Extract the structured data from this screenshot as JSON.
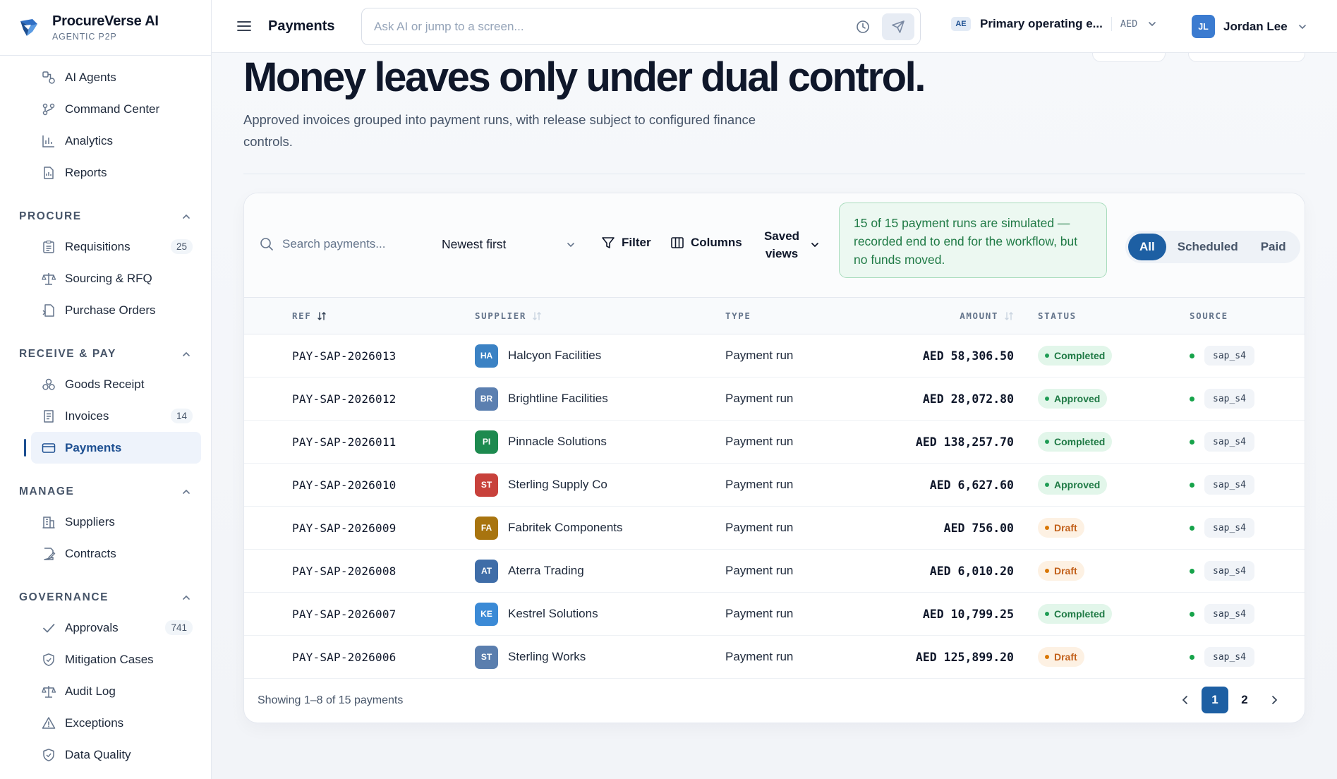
{
  "brand": {
    "name": "ProcureVerse AI",
    "subtitle": "AGENTIC P2P"
  },
  "sidebar": {
    "top_items": [
      {
        "label": "AI Agents",
        "icon": "agents-icon"
      },
      {
        "label": "Command Center",
        "icon": "command-icon"
      },
      {
        "label": "Analytics",
        "icon": "analytics-icon"
      },
      {
        "label": "Reports",
        "icon": "reports-icon"
      }
    ],
    "groups": [
      {
        "title": "PROCURE",
        "items": [
          {
            "label": "Requisitions",
            "count": "25",
            "icon": "requisitions-icon"
          },
          {
            "label": "Sourcing & RFQ",
            "count": "",
            "icon": "scale-icon"
          },
          {
            "label": "Purchase Orders",
            "count": "",
            "icon": "purchase-order-icon"
          }
        ]
      },
      {
        "title": "RECEIVE & PAY",
        "items": [
          {
            "label": "Goods Receipt",
            "count": "",
            "icon": "goods-receipt-icon"
          },
          {
            "label": "Invoices",
            "count": "14",
            "icon": "invoice-icon"
          },
          {
            "label": "Payments",
            "count": "",
            "icon": "credit-card-icon",
            "active": true
          }
        ]
      },
      {
        "title": "MANAGE",
        "items": [
          {
            "label": "Suppliers",
            "count": "",
            "icon": "building-icon"
          },
          {
            "label": "Contracts",
            "count": "",
            "icon": "contract-icon"
          }
        ]
      },
      {
        "title": "GOVERNANCE",
        "items": [
          {
            "label": "Approvals",
            "count": "741",
            "icon": "check-icon"
          },
          {
            "label": "Mitigation Cases",
            "count": "",
            "icon": "shield-icon"
          },
          {
            "label": "Audit Log",
            "count": "",
            "icon": "scale-icon"
          },
          {
            "label": "Exceptions",
            "count": "",
            "icon": "warning-icon"
          },
          {
            "label": "Data Quality",
            "count": "",
            "icon": "shield-check-icon"
          }
        ]
      }
    ]
  },
  "topbar": {
    "page_title": "Payments",
    "ask_placeholder": "Ask AI or jump to a screen...",
    "entity_badge": "AE",
    "entity_name": "Primary operating e...",
    "currency": "AED",
    "user_initials": "JL",
    "user_name": "Jordan Lee"
  },
  "hero": {
    "title": "Money leaves only under dual control.",
    "subtitle": "Approved invoices grouped into payment runs, with release subject to configured finance controls."
  },
  "toolbar": {
    "search_placeholder": "Search payments...",
    "sort_value": "Newest first",
    "filter_label": "Filter",
    "columns_label": "Columns",
    "saved_views_label": "Saved views",
    "notice": "15 of 15 payment runs are simulated — recorded end to end for the workflow, but no funds moved.",
    "segments": [
      "All",
      "Scheduled",
      "Paid"
    ],
    "active_segment": "All"
  },
  "table": {
    "headers": {
      "ref": "REF",
      "supplier": "SUPPLIER",
      "type": "TYPE",
      "amount": "AMOUNT",
      "status": "STATUS",
      "source": "SOURCE"
    },
    "rows": [
      {
        "ref": "PAY-SAP-2026013",
        "initials": "HA",
        "supplier": "Halcyon Facilities",
        "type": "Payment run",
        "amount": "AED 58,306.50",
        "status": "Completed",
        "source": "sap_s4",
        "color": "#3b82c4"
      },
      {
        "ref": "PAY-SAP-2026012",
        "initials": "BR",
        "supplier": "Brightline Facilities",
        "type": "Payment run",
        "amount": "AED 28,072.80",
        "status": "Approved",
        "source": "sap_s4",
        "color": "#5b7fb0"
      },
      {
        "ref": "PAY-SAP-2026011",
        "initials": "PI",
        "supplier": "Pinnacle Solutions",
        "type": "Payment run",
        "amount": "AED 138,257.70",
        "status": "Completed",
        "source": "sap_s4",
        "color": "#1d8a4f"
      },
      {
        "ref": "PAY-SAP-2026010",
        "initials": "ST",
        "supplier": "Sterling Supply Co",
        "type": "Payment run",
        "amount": "AED 6,627.60",
        "status": "Approved",
        "source": "sap_s4",
        "color": "#c8413b"
      },
      {
        "ref": "PAY-SAP-2026009",
        "initials": "FA",
        "supplier": "Fabritek Components",
        "type": "Payment run",
        "amount": "AED 756.00",
        "status": "Draft",
        "source": "sap_s4",
        "color": "#a8740f"
      },
      {
        "ref": "PAY-SAP-2026008",
        "initials": "AT",
        "supplier": "Aterra Trading",
        "type": "Payment run",
        "amount": "AED 6,010.20",
        "status": "Draft",
        "source": "sap_s4",
        "color": "#3f6da8"
      },
      {
        "ref": "PAY-SAP-2026007",
        "initials": "KE",
        "supplier": "Kestrel Solutions",
        "type": "Payment run",
        "amount": "AED 10,799.25",
        "status": "Completed",
        "source": "sap_s4",
        "color": "#3b8ad6"
      },
      {
        "ref": "PAY-SAP-2026006",
        "initials": "ST",
        "supplier": "Sterling Works",
        "type": "Payment run",
        "amount": "AED 125,899.20",
        "status": "Draft",
        "source": "sap_s4",
        "color": "#5a7eae"
      }
    ]
  },
  "footer": {
    "showing": "Showing 1–8 of 15 payments",
    "pages": [
      "1",
      "2"
    ],
    "current_page": "1"
  }
}
